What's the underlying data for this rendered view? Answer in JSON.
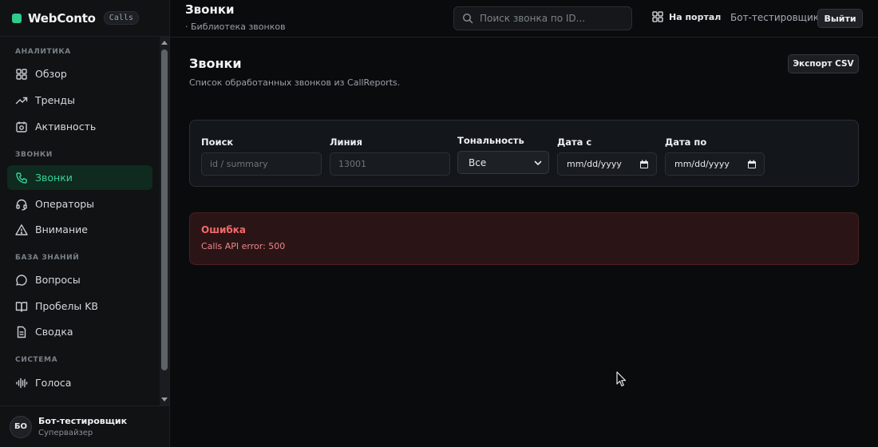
{
  "brand": {
    "name": "WebConto",
    "badge": "Calls"
  },
  "sidebar": {
    "sections": [
      {
        "title": "АНАЛИТИКА"
      },
      {
        "title": "ЗВОНКИ"
      },
      {
        "title": "БАЗА ЗНАНИЙ"
      },
      {
        "title": "СИСТЕМА"
      }
    ],
    "items": [
      {
        "label": "Обзор",
        "icon": "grid-icon"
      },
      {
        "label": "Тренды",
        "icon": "trend-icon"
      },
      {
        "label": "Активность",
        "icon": "activity-icon"
      },
      {
        "label": "Звонки",
        "icon": "phone-icon",
        "active": true
      },
      {
        "label": "Операторы",
        "icon": "headset-icon"
      },
      {
        "label": "Внимание",
        "icon": "warning-icon"
      },
      {
        "label": "Вопросы",
        "icon": "chat-icon"
      },
      {
        "label": "Пробелы KB",
        "icon": "book-icon"
      },
      {
        "label": "Сводка",
        "icon": "document-icon"
      },
      {
        "label": "Голоса",
        "icon": "waveform-icon"
      }
    ]
  },
  "user": {
    "initials": "БО",
    "name": "Бот-тестировщик",
    "role": "Супервайзер"
  },
  "topbar": {
    "title": "Звонки",
    "subtitle": "· Библиотека звонков",
    "search_placeholder": "Поиск звонка по ID...",
    "portal_label": "На портал",
    "user_name": "Бот-тестировщик",
    "logout_label": "Выйти"
  },
  "main": {
    "title": "Звонки",
    "subtitle": "Список обработанных звонков из CallReports.",
    "export_label": "Экспорт CSV"
  },
  "filters": {
    "search_label": "Поиск",
    "search_placeholder": "id / summary",
    "line_label": "Линия",
    "line_placeholder": "13001",
    "tone_label": "Тональность",
    "tone_value": "Все",
    "date_from_label": "Дата с",
    "date_from_value": "mm/dd/yyyy",
    "date_to_label": "Дата по",
    "date_to_value": "mm/dd/yyyy"
  },
  "error": {
    "title": "Ошибка",
    "message": "Calls API error: 500"
  },
  "colors": {
    "accent": "#35d39a",
    "error": "#f06a6a",
    "background": "#0a0b0d"
  }
}
